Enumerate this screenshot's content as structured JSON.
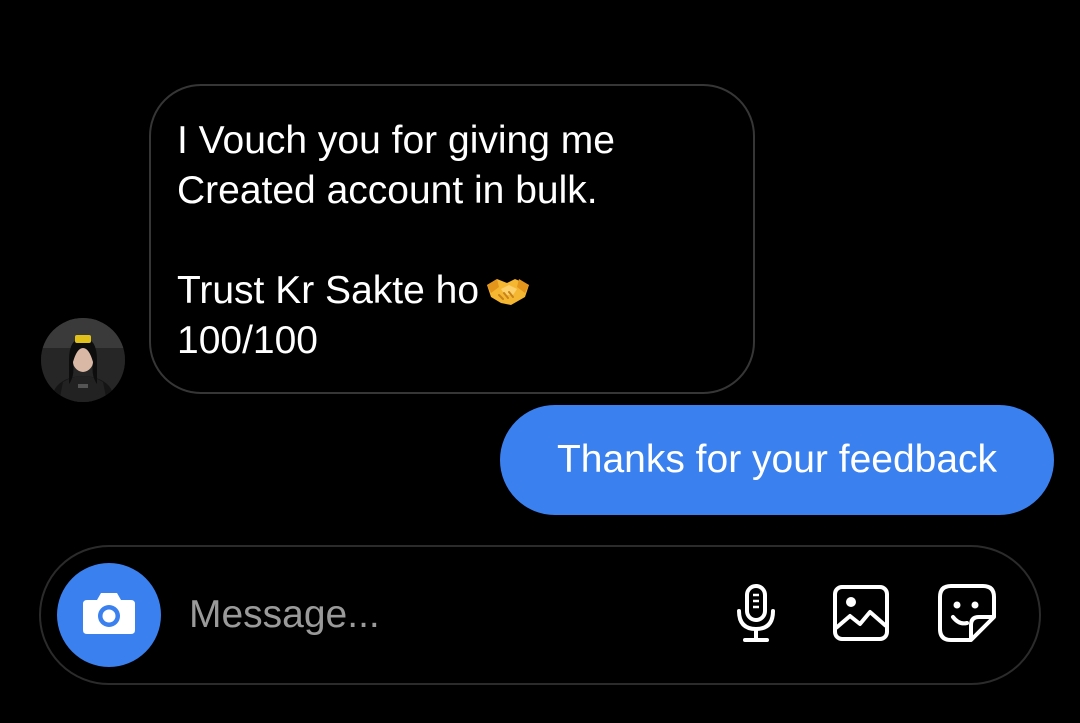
{
  "conversation": {
    "incoming": {
      "lines": [
        "I Vouch you for giving me",
        "Created account in bulk.",
        "",
        "Trust Kr Sakte ho",
        "100/100"
      ],
      "emoji": "handshake-emoji"
    },
    "outgoing": {
      "text": "Thanks for your feedback"
    }
  },
  "composer": {
    "placeholder": "Message...",
    "camera_icon": "camera-icon",
    "mic_icon": "microphone-icon",
    "gallery_icon": "image-icon",
    "sticker_icon": "sticker-icon"
  },
  "colors": {
    "background": "#000000",
    "accent": "#3a80ef",
    "incoming_border": "#363636",
    "composer_border": "#2b2b2b",
    "placeholder": "#9a9a9a"
  }
}
